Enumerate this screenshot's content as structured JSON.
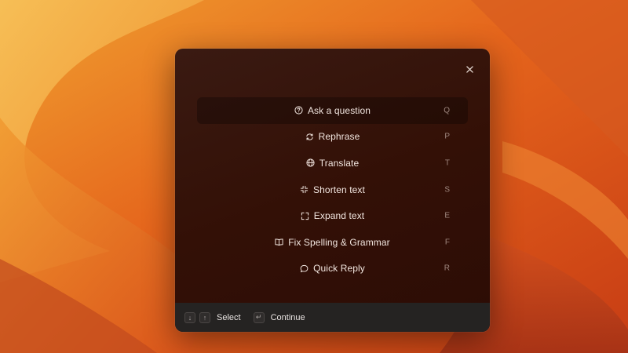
{
  "dialog": {
    "close_label": "×",
    "items": [
      {
        "label": "Ask a question",
        "key": "Q",
        "icon": "question-circle-icon",
        "selected": true
      },
      {
        "label": "Rephrase",
        "key": "P",
        "icon": "refresh-icon",
        "selected": false
      },
      {
        "label": "Translate",
        "key": "T",
        "icon": "globe-icon",
        "selected": false
      },
      {
        "label": "Shorten text",
        "key": "S",
        "icon": "collapse-icon",
        "selected": false
      },
      {
        "label": "Expand text",
        "key": "E",
        "icon": "expand-icon",
        "selected": false
      },
      {
        "label": "Fix Spelling & Grammar",
        "key": "F",
        "icon": "book-icon",
        "selected": false
      },
      {
        "label": "Quick Reply",
        "key": "R",
        "icon": "speech-bubble-icon",
        "selected": false
      }
    ]
  },
  "footer": {
    "down_key": "↓",
    "up_key": "↑",
    "select_label": "Select",
    "enter_key": "↵",
    "continue_label": "Continue"
  },
  "colors": {
    "dialog_bg": "#331006",
    "selected_bg": "#220a05",
    "footer_bg": "#252322",
    "text": "#f2e6e0",
    "muted": "#a08880"
  }
}
